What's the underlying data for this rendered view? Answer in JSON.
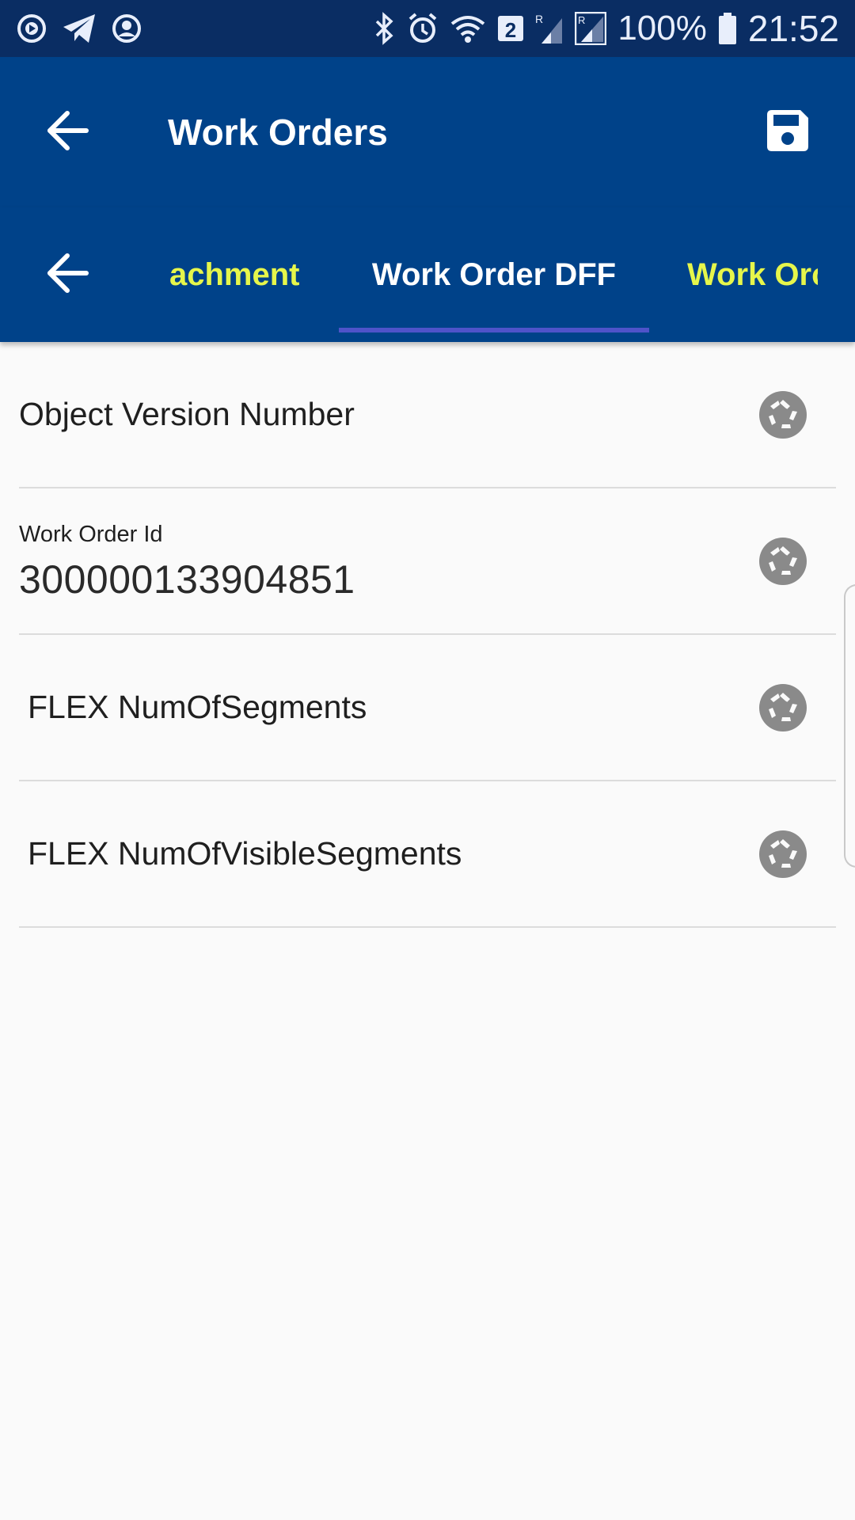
{
  "status_bar": {
    "notification_icons": [
      "play-circle-icon",
      "telegram-icon",
      "account-circle-icon"
    ],
    "system_icons": [
      "bluetooth-icon",
      "alarm-icon",
      "wifi-icon",
      "sim-2-icon",
      "signal-roaming-icon",
      "signal-icon"
    ],
    "sim_badge": "2",
    "battery_percent": "100%",
    "time": "21:52"
  },
  "app_bar": {
    "title": "Work Orders",
    "back_icon": "arrow-left-icon",
    "save_icon": "floppy-disk-icon"
  },
  "tabs": {
    "back_icon": "arrow-left-icon",
    "items": [
      {
        "label": "achment",
        "state": "inactive"
      },
      {
        "label": "Work Order DFF",
        "state": "active"
      },
      {
        "label": "Work Orc",
        "state": "inactive"
      }
    ]
  },
  "fields": [
    {
      "label": "Object Version Number",
      "value": "",
      "icon": "camera-shutter-icon"
    },
    {
      "label": "Work Order Id",
      "value": "300000133904851",
      "icon": "camera-shutter-icon"
    },
    {
      "label": "FLEX NumOfSegments",
      "value": "",
      "icon": "camera-shutter-icon"
    },
    {
      "label": "FLEX NumOfVisibleSegments",
      "value": "",
      "icon": "camera-shutter-icon"
    }
  ],
  "colors": {
    "status_bar": "#0a2d63",
    "app_bar": "#004289",
    "tab_inactive": "#e6f64b",
    "tab_indicator": "#4f53c9",
    "background": "#fafafa",
    "icon_gray": "#8a8a8a"
  }
}
